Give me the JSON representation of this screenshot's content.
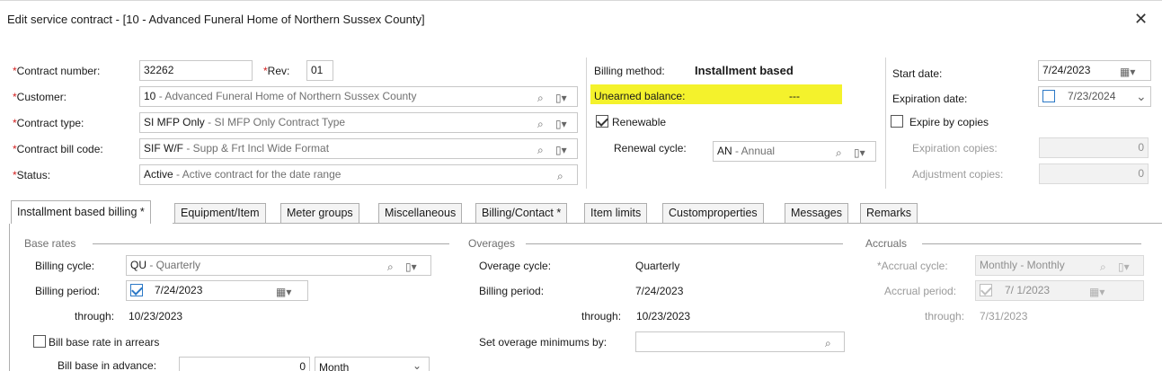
{
  "window": {
    "title": "Edit service contract - [10 - Advanced Funeral Home of Northern Sussex County]",
    "close_glyph": "✕"
  },
  "contract": {
    "contract_number_label": "Contract number:",
    "contract_number_value": "32262",
    "rev_label": "Rev:",
    "rev_value": "01",
    "customer_label": "Customer:",
    "customer_code": "10",
    "customer_desc": " - Advanced Funeral Home of Northern Sussex County",
    "contract_type_label": "Contract type:",
    "contract_type_code": "SI MFP Only",
    "contract_type_desc": " - SI MFP Only Contract Type",
    "bill_code_label": "Contract bill code:",
    "bill_code_code": "SIF W/F",
    "bill_code_desc": " - Supp & Frt Incl Wide Format",
    "status_label": "Status:",
    "status_code": "Active",
    "status_desc": " - Active contract for the date range"
  },
  "billing": {
    "method_label": "Billing method:",
    "method_value": "Installment based",
    "unearned_label": "Unearned balance:",
    "unearned_value": "---",
    "renewable_label": "Renewable",
    "renewable_checked": true,
    "renewal_cycle_label": "Renewal cycle:",
    "renewal_cycle_code": "AN",
    "renewal_cycle_desc": " - Annual"
  },
  "dates": {
    "start_label": "Start date:",
    "start_value": "7/24/2023",
    "expiration_label": "Expiration date:",
    "expiration_value": "7/23/2024",
    "expire_by_copies_label": "Expire by copies",
    "expiration_copies_label": "Expiration copies:",
    "expiration_copies_value": "0",
    "adjustment_copies_label": "Adjustment copies:",
    "adjustment_copies_value": "0"
  },
  "tabs": [
    {
      "label": "Installment based billing *"
    },
    {
      "label": "Equipment/Item"
    },
    {
      "label": "Meter groups"
    },
    {
      "label": "Miscellaneous"
    },
    {
      "label": "Billing/Contact *"
    },
    {
      "label": "Item limits"
    },
    {
      "label": "Customproperties"
    },
    {
      "label": "Messages"
    },
    {
      "label": "Remarks"
    }
  ],
  "base_rates": {
    "group_label": "Base rates",
    "cycle_label": "Billing cycle:",
    "cycle_code": "QU",
    "cycle_desc": " - Quarterly",
    "period_label": "Billing period:",
    "period_value": "7/24/2023",
    "through_label": "through:",
    "through_value": "10/23/2023",
    "arrears_label": "Bill base rate in arrears",
    "advance_label": "Bill base in advance:",
    "advance_value": "0",
    "advance_unit": "Month"
  },
  "overages": {
    "group_label": "Overages",
    "cycle_label": "Overage cycle:",
    "cycle_value": "Quarterly",
    "period_label": "Billing period:",
    "period_value": "7/24/2023",
    "through_label": "through:",
    "through_value": "10/23/2023",
    "minimums_label": "Set overage minimums by:",
    "minimums_value": ""
  },
  "accruals": {
    "group_label": "Accruals",
    "cycle_label": "Accrual cycle:",
    "cycle_value": "Monthly - Monthly",
    "period_label": "Accrual period:",
    "period_value": "7/ 1/2023",
    "through_label": "through:",
    "through_value": "7/31/2023"
  },
  "icons": {
    "search": "🔍",
    "dropdown": "▾",
    "calendar": "▦",
    "chevron": "⌄"
  },
  "colors": {
    "required": "#d32020",
    "highlight": "#f4f22c",
    "accent": "#2b78c6"
  }
}
